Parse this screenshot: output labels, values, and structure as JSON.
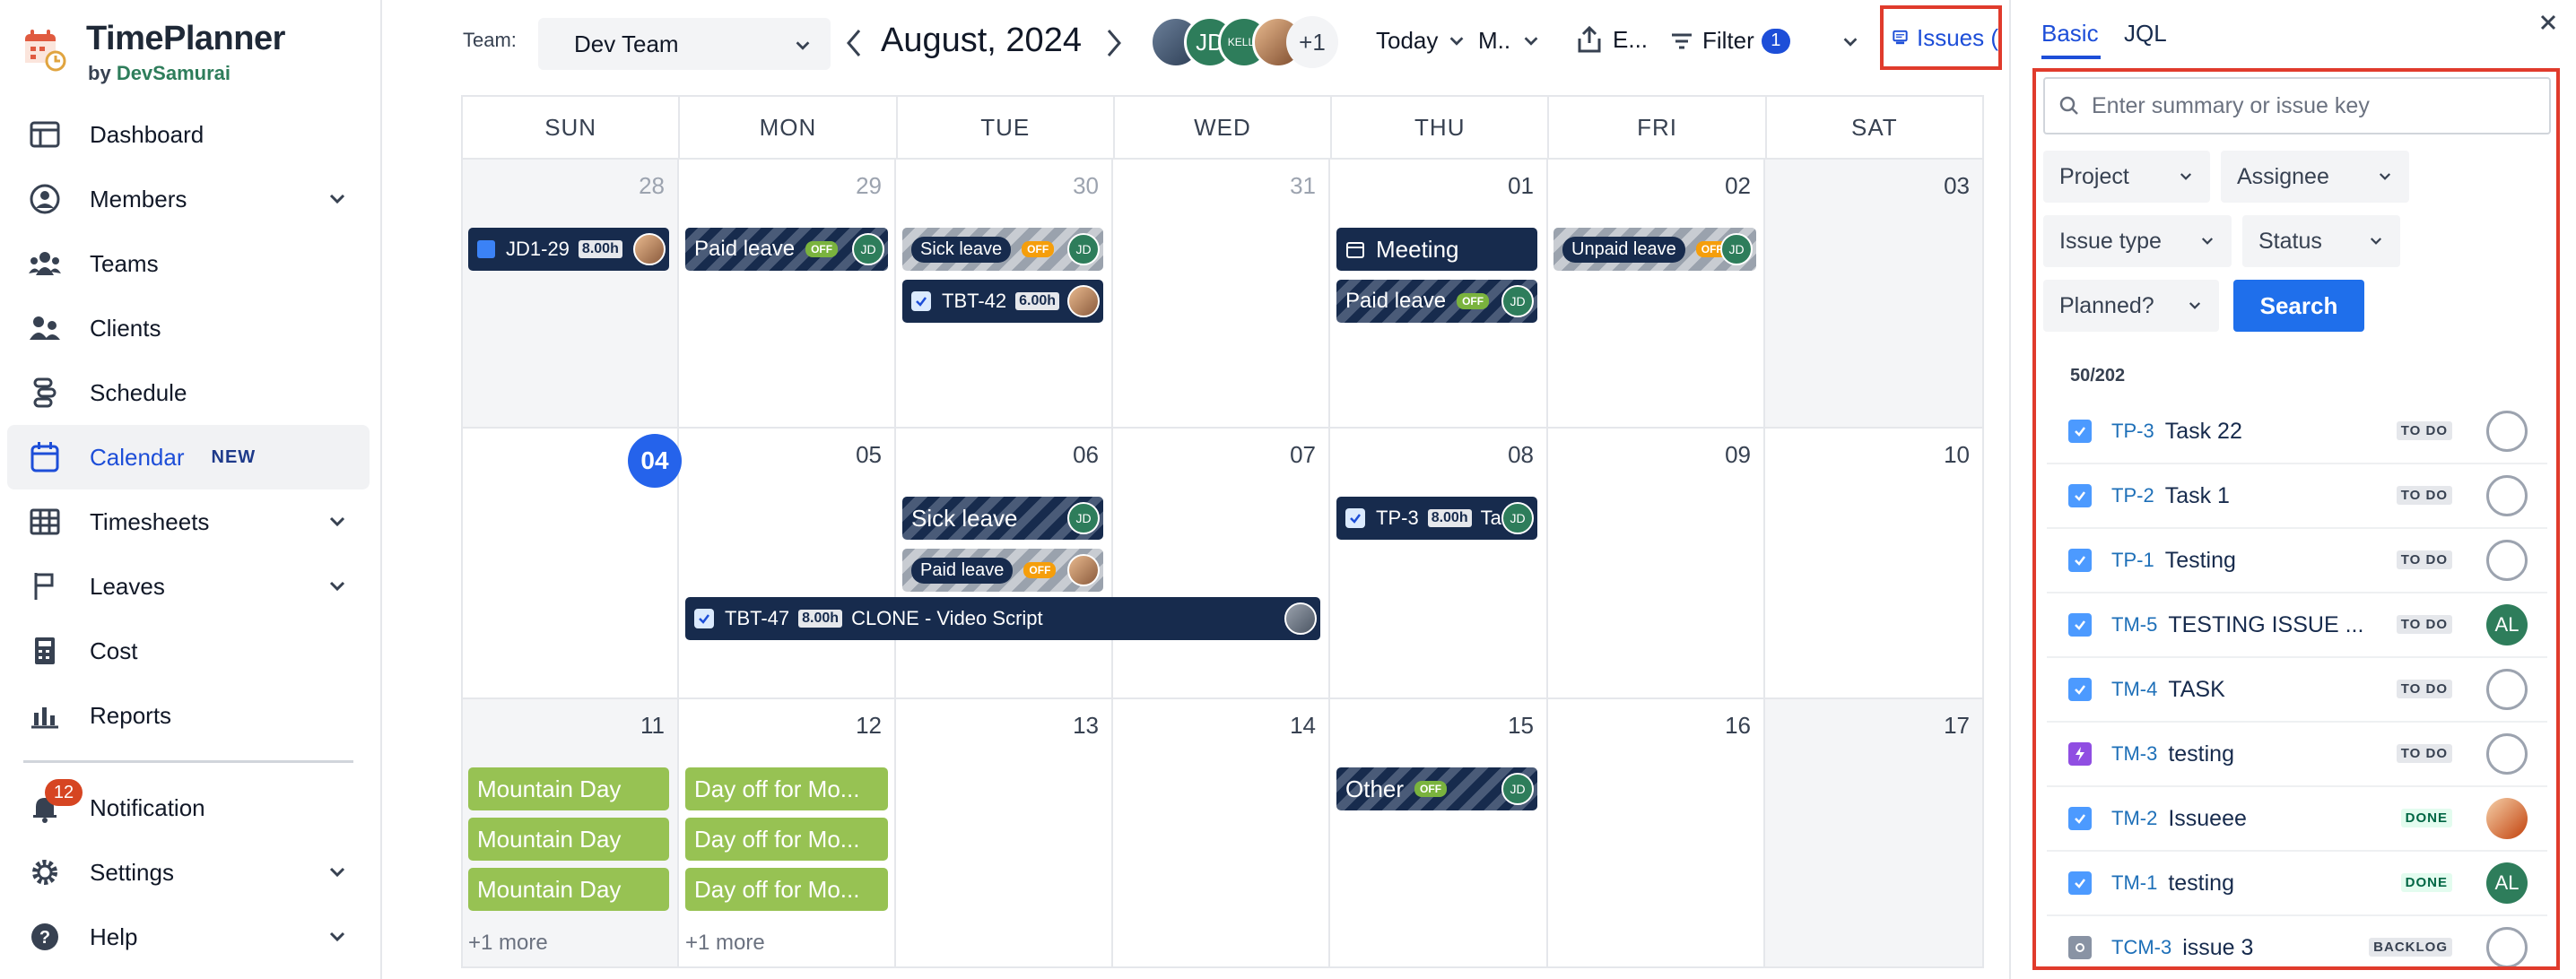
{
  "app": {
    "title": "TimePlanner",
    "by": "by",
    "vendor": "DevSamurai"
  },
  "sidebar": {
    "items": [
      {
        "label": "Dashboard"
      },
      {
        "label": "Members"
      },
      {
        "label": "Teams"
      },
      {
        "label": "Clients"
      },
      {
        "label": "Schedule"
      },
      {
        "label": "Calendar",
        "badge": "NEW"
      },
      {
        "label": "Timesheets"
      },
      {
        "label": "Leaves"
      },
      {
        "label": "Cost"
      },
      {
        "label": "Reports"
      }
    ],
    "bottom": [
      {
        "label": "Notification",
        "badge": "12"
      },
      {
        "label": "Settings"
      },
      {
        "label": "Help"
      }
    ]
  },
  "toolbar": {
    "team_label": "Team:",
    "team_value": "Dev Team",
    "month": "August, 2024",
    "avatars": [
      "JD",
      "KELLY",
      "+1"
    ],
    "today_label": "Today",
    "view_label": "M..",
    "export_label": "E...",
    "filter_label": "Filter",
    "filter_count": "1",
    "issues_label": "Issues ("
  },
  "calendar": {
    "days_of_week": [
      "SUN",
      "MON",
      "TUE",
      "WED",
      "THU",
      "FRI",
      "SAT"
    ],
    "weeks": [
      [
        "28",
        "29",
        "30",
        "31",
        "01",
        "02",
        "03"
      ],
      [
        "04",
        "05",
        "06",
        "07",
        "08",
        "09",
        "10"
      ],
      [
        "11",
        "12",
        "13",
        "14",
        "15",
        "16",
        "17"
      ]
    ],
    "events": {
      "jd1_29": {
        "key": "JD1-29",
        "hours": "8.00h"
      },
      "paid_leave_mon": {
        "label": "Paid leave",
        "tag": "OFF",
        "avatar": "JD"
      },
      "sick_leave_tue": {
        "label": "Sick leave",
        "tag": "OFF",
        "avatar": "JD"
      },
      "tbt42": {
        "key": "TBT-42",
        "hours": "6.00h"
      },
      "meeting": {
        "label": "Meeting"
      },
      "paid_leave_thu": {
        "label": "Paid leave",
        "tag": "OFF",
        "avatar": "JD"
      },
      "unpaid_leave": {
        "label": "Unpaid leave",
        "tag": "OFF",
        "avatar": "JD"
      },
      "sick_leave_w2": {
        "label": "Sick leave",
        "avatar": "JD"
      },
      "paid_leave_w2": {
        "label": "Paid leave",
        "tag": "OFF"
      },
      "tp3": {
        "key": "TP-3",
        "hours": "8.00h",
        "summary": "Ta",
        "avatar": "JD"
      },
      "tbt47": {
        "key": "TBT-47",
        "hours": "8.00h",
        "summary": "CLONE - Video Script"
      },
      "mountain_1": {
        "label": "Mountain Day"
      },
      "mountain_2": {
        "label": "Mountain Day"
      },
      "mountain_3": {
        "label": "Mountain Day"
      },
      "dayoff_1": {
        "label": "Day off for Mo..."
      },
      "dayoff_2": {
        "label": "Day off for Mo..."
      },
      "dayoff_3": {
        "label": "Day off for Mo..."
      },
      "other": {
        "label": "Other",
        "tag": "OFF",
        "avatar": "JD"
      }
    },
    "more_sun": "+1 more",
    "more_mon": "+1 more"
  },
  "panel": {
    "tabs": [
      {
        "label": "Basic"
      },
      {
        "label": "JQL"
      }
    ],
    "search_placeholder": "Enter summary or issue key",
    "filters": {
      "project": "Project",
      "assignee": "Assignee",
      "issue_type": "Issue type",
      "status": "Status",
      "planned": "Planned?"
    },
    "search_button": "Search",
    "count": "50/202",
    "issues": [
      {
        "key": "TP-3",
        "summary": "Task 22",
        "status": "TO DO",
        "assignee": ""
      },
      {
        "key": "TP-2",
        "summary": "Task 1",
        "status": "TO DO",
        "assignee": ""
      },
      {
        "key": "TP-1",
        "summary": "Testing",
        "status": "TO DO",
        "assignee": ""
      },
      {
        "key": "TM-5",
        "summary": "TESTING ISSUE ...",
        "status": "TO DO",
        "assignee": "AL"
      },
      {
        "key": "TM-4",
        "summary": "TASK",
        "status": "TO DO",
        "assignee": ""
      },
      {
        "key": "TM-3",
        "summary": "testing",
        "status": "TO DO",
        "assignee": ""
      },
      {
        "key": "TM-2",
        "summary": "Issueee",
        "status": "DONE",
        "assignee": ""
      },
      {
        "key": "TM-1",
        "summary": "testing",
        "status": "DONE",
        "assignee": "AL"
      },
      {
        "key": "TCM-3",
        "summary": "issue 3",
        "status": "BACKLOG",
        "assignee": ""
      }
    ]
  },
  "colors": {
    "accent": "#1d4ed8",
    "event_dark": "#172b4d",
    "holiday_green": "#97c253",
    "highlight_red": "#e03b2c"
  }
}
